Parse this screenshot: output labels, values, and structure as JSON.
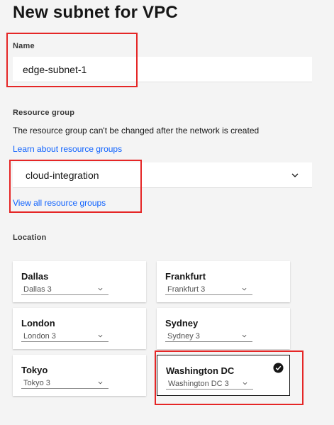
{
  "page": {
    "title": "New subnet for VPC"
  },
  "name_field": {
    "label": "Name",
    "value": "edge-subnet-1"
  },
  "resource_group": {
    "label": "Resource group",
    "helper": "The resource group can't be changed after the network is created",
    "learn_link": "Learn about resource groups",
    "selected": "cloud-integration",
    "view_all_link": "View all resource groups"
  },
  "location": {
    "label": "Location",
    "tiles": [
      {
        "name": "Dallas",
        "zone": "Dallas 3",
        "selected": false
      },
      {
        "name": "Frankfurt",
        "zone": "Frankfurt 3",
        "selected": false
      },
      {
        "name": "London",
        "zone": "London 3",
        "selected": false
      },
      {
        "name": "Sydney",
        "zone": "Sydney 3",
        "selected": false
      },
      {
        "name": "Tokyo",
        "zone": "Tokyo 3",
        "selected": false
      },
      {
        "name": "Washington DC",
        "zone": "Washington DC 3",
        "selected": true
      }
    ]
  },
  "colors": {
    "accent": "#0f62fe",
    "highlight": "#e52626",
    "background": "#f4f4f4"
  },
  "icons": {
    "dropdown": "chevron-down-icon",
    "selected": "checkmark-filled-icon"
  }
}
